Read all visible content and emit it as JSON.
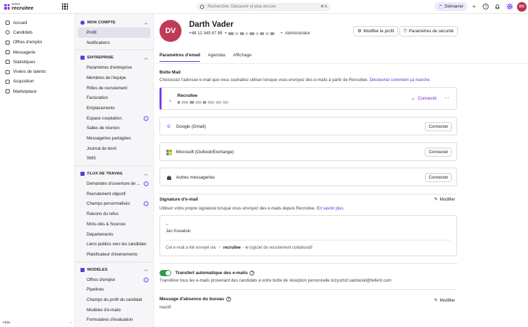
{
  "app": {
    "brand_small": "tellent",
    "brand": "recruitee"
  },
  "topbar": {
    "search_placeholder": "Rechercher, Découvrir et plus encore",
    "search_shortcut": "⌘ K",
    "start_label": "Démarrer",
    "avatar_initials": "DV"
  },
  "nav": {
    "items": [
      {
        "label": "Accueil"
      },
      {
        "label": "Candidats"
      },
      {
        "label": "Offres d'emploi"
      },
      {
        "label": "Messagerie"
      },
      {
        "label": "Statistiques"
      },
      {
        "label": "Viviers de talents"
      },
      {
        "label": "Acquisition"
      },
      {
        "label": "Marketplace"
      }
    ],
    "hide_label": "Hide"
  },
  "sub": {
    "account": {
      "title": "MON COMPTE",
      "items": [
        "Profil",
        "Notifications"
      ]
    },
    "company": {
      "title": "ENTREPRISE",
      "items": [
        "Paramètres d'entreprise",
        "Membres de l'équipe",
        "Rôles de recrutement",
        "Facturation",
        "Emplacements",
        "Espace cooptation",
        "Salles de réunion",
        "Messageries partagées",
        "Journal de bord",
        "SMS"
      ]
    },
    "workflow": {
      "title": "FLUX DE TRAVAIL",
      "items": [
        "Demandes d'ouverture de ...",
        "Recrutement objectif",
        "Champs personnalisés",
        "Raisons du refus",
        "Mots-clés & Sources",
        "Départements",
        "Liens publics vers les candidats",
        "Planificateur d'événements"
      ]
    },
    "models": {
      "title": "MODÈLES",
      "items": [
        "Offres d'emploi",
        "Pipelines",
        "Champs du profil du candidat",
        "Modèles d'e-mails",
        "Formulaires d'évaluation"
      ]
    }
  },
  "profile": {
    "initials": "DV",
    "name": "Darth Vader",
    "phone": "+48 12 345 67 89",
    "role": "Administrator",
    "edit_profile": "Modifier le profil",
    "security": "Paramètres de sécurité"
  },
  "tabs": [
    "Paramètres d'email",
    "Agendas",
    "Affichage"
  ],
  "mailbox": {
    "title": "Boîte Mail",
    "description": "Choisissez l'adresse e-mail que vous souhaitez utiliser lorsque vous envoyez des e-mails à partir de Recruitee.",
    "link": "Découvrez comment ça marche",
    "providers": [
      {
        "name": "Recruitee",
        "status": "Connecté"
      },
      {
        "name": "Google (Gmail)",
        "action": "Connecter"
      },
      {
        "name": "Microsoft (Outlook/Exchange)",
        "action": "Connecter"
      },
      {
        "name": "Autres messageries",
        "action": "Connecter"
      }
    ]
  },
  "signature": {
    "title": "Signature d'e-mail",
    "edit": "Modifier",
    "description": "Utilisez votre propre signature lorsque vous envoyez des e-mails depuis Recruitee.",
    "link": "En savoir plus",
    "dashes": "--",
    "name": "Jan Kowalski",
    "sent_via": "Cet e-mail a été envoyé via",
    "sent_brand": "recruitee",
    "sent_suffix": "- le logiciel de recrutement collaboratif"
  },
  "forward": {
    "title": "Transfert automatique des e-mails",
    "enabled": true,
    "description": "Transférer tous les e-mails provenant des candidats à votre boîte de réception personnelle krzysztof.sadowski@tellent.com"
  },
  "absence": {
    "title": "Message d'absence du bureau",
    "edit": "Modifier",
    "status": "Inactif"
  },
  "colors": {
    "accent": "#6d28d9",
    "avatar": "#c03a57",
    "toggle": "#2d9b4f"
  }
}
